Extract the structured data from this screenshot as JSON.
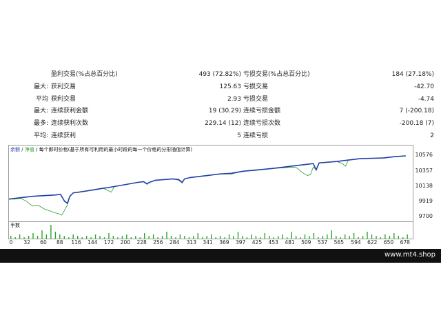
{
  "stats": {
    "rows": [
      {
        "label": "",
        "name1": "盈利交易(%占总百分比)",
        "value1": "493 (72.82%)",
        "name2": "亏损交易(%占总百分比)",
        "value2": "184 (27.18%)"
      },
      {
        "label": "最大:",
        "name1": "获利交易",
        "value1": "125.63",
        "name2": "亏损交易",
        "value2": "-42.70"
      },
      {
        "label": "平均",
        "name1": "获利交易",
        "value1": "2.93",
        "name2": "亏损交易",
        "value2": "-4.74"
      },
      {
        "label": "最大:",
        "name1": "连续获利金额",
        "value1": "19 (30.29)",
        "name2": "连续亏损金额",
        "value2": "7 (-200.18)"
      },
      {
        "label": "最多:",
        "name1": "连续获利次数",
        "value1": "229.14 (12)",
        "name2": "连续亏损次数",
        "value2": "-200.18 (7)"
      },
      {
        "label": "平均:",
        "name1": "连续获利",
        "value1": "5",
        "name2": "连续亏损",
        "value2": "2"
      }
    ]
  },
  "chart": {
    "title_balance": "余额",
    "title_sep1": " / ",
    "title_equity": "净值",
    "title_rest": " / 每个即时价格(基于所有可利用的最小时段的每一个价格的分形插值计算)",
    "volume_label": "手数",
    "colors": {
      "balance": "#1f3fa8",
      "equity": "#2a9c2a",
      "volume": "#22aa22"
    }
  },
  "chart_data": {
    "type": "line",
    "y_ticks": [
      "10576",
      "10357",
      "10138",
      "9919",
      "9700"
    ],
    "ylim": [
      9700,
      10650
    ],
    "x_ticks": [
      "0",
      "32",
      "60",
      "88",
      "116",
      "144",
      "172",
      "200",
      "228",
      "256",
      "284",
      "313",
      "341",
      "369",
      "397",
      "425",
      "453",
      "481",
      "509",
      "537",
      "565",
      "594",
      "622",
      "650",
      "678"
    ],
    "xlim": [
      0,
      690
    ],
    "series": [
      {
        "key": "balance",
        "x": [
          0,
          20,
          40,
          60,
          80,
          88,
          95,
          100,
          104,
          110,
          120,
          150,
          180,
          200,
          220,
          230,
          236,
          240,
          250,
          280,
          290,
          296,
          300,
          310,
          340,
          360,
          380,
          400,
          450,
          500,
          520,
          525,
          530,
          560,
          580,
          590,
          600,
          640,
          660,
          678
        ],
        "y": [
          9960,
          9980,
          10000,
          10010,
          10020,
          10030,
          9930,
          9900,
          10000,
          10050,
          10060,
          10100,
          10140,
          10170,
          10200,
          10210,
          10180,
          10200,
          10230,
          10250,
          10240,
          10200,
          10250,
          10270,
          10300,
          10320,
          10330,
          10360,
          10400,
          10450,
          10470,
          10380,
          10480,
          10500,
          10520,
          10530,
          10540,
          10550,
          10570,
          10580
        ]
      },
      {
        "key": "equity",
        "x": [
          0,
          10,
          20,
          30,
          40,
          50,
          60,
          70,
          80,
          85,
          90,
          95,
          100,
          104,
          110,
          120,
          140,
          160,
          175,
          180,
          200,
          220,
          230,
          236,
          240,
          250,
          280,
          290,
          296,
          300,
          310,
          340,
          360,
          380,
          400,
          420,
          450,
          470,
          490,
          500,
          505,
          510,
          515,
          520,
          525,
          530,
          560,
          570,
          575,
          580,
          600,
          640,
          660,
          678
        ],
        "y": [
          9960,
          9960,
          9970,
          9930,
          9860,
          9870,
          9820,
          9790,
          9760,
          9750,
          9730,
          9800,
          9880,
          10000,
          10050,
          10060,
          10090,
          10120,
          10060,
          10140,
          10170,
          10200,
          10210,
          10170,
          10200,
          10230,
          10250,
          10230,
          10190,
          10250,
          10270,
          10300,
          10320,
          10320,
          10360,
          10370,
          10400,
          10410,
          10420,
          10350,
          10320,
          10300,
          10310,
          10420,
          10380,
          10480,
          10500,
          10470,
          10430,
          10520,
          10540,
          10550,
          10570,
          10580
        ]
      }
    ],
    "volume": [
      0.2,
      0.1,
      0.3,
      0.1,
      0.2,
      0.4,
      0.2,
      0.6,
      0.3,
      1.0,
      0.5,
      0.3,
      0.2,
      0.1,
      0.3,
      0.2,
      0.1,
      0.2,
      0.1,
      0.3,
      0.2,
      0.1,
      0.4,
      0.2,
      0.1,
      0.2,
      0.3,
      0.1,
      0.2,
      0.1,
      0.4,
      0.2,
      0.3,
      0.1,
      0.2,
      0.5,
      0.2,
      0.1,
      0.3,
      0.2,
      0.1,
      0.2,
      0.4,
      0.1,
      0.2,
      0.3,
      0.1,
      0.2,
      0.1,
      0.3,
      0.2,
      0.5,
      0.2,
      0.1,
      0.3,
      0.2,
      0.1,
      0.4,
      0.2,
      0.1,
      0.2,
      0.3,
      0.1,
      0.5,
      0.2,
      0.1,
      0.3,
      0.2,
      0.4,
      0.1,
      0.2,
      0.3,
      0.6,
      0.2,
      0.1,
      0.3,
      0.2,
      0.4,
      0.1,
      0.2,
      0.5,
      0.3,
      0.2,
      0.1,
      0.3,
      0.2,
      0.4,
      0.2,
      0.1,
      0.3
    ],
    "grid": false
  },
  "footer": {
    "watermark": "www.mt4.shop"
  }
}
